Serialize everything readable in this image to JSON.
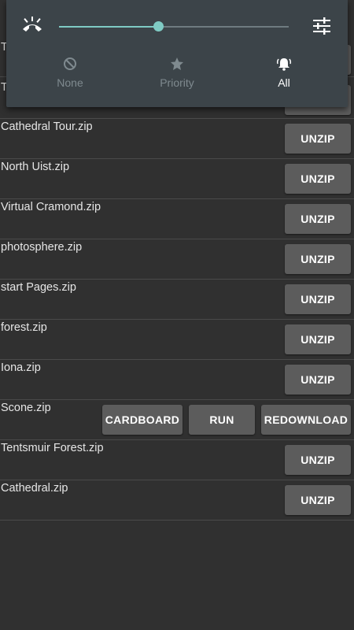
{
  "files": [
    {
      "name": "Cathedral Tour.zip",
      "action": "UNZIP"
    },
    {
      "name": "North Uist.zip",
      "action": "UNZIP"
    },
    {
      "name": "Virtual Cramond.zip",
      "action": "UNZIP"
    },
    {
      "name": "photosphere.zip",
      "action": "UNZIP"
    },
    {
      "name": "start Pages.zip",
      "action": "UNZIP"
    },
    {
      "name": "forest.zip",
      "action": "UNZIP"
    },
    {
      "name": "Iona.zip",
      "action": "UNZIP"
    },
    {
      "name": "Scone.zip",
      "actions": [
        "CARDBOARD",
        "RUN",
        "REDOWNLOAD"
      ]
    },
    {
      "name": "Tentsmuir Forest.zip",
      "action": "UNZIP"
    },
    {
      "name": "Cathedral.zip",
      "action": "UNZIP"
    }
  ],
  "hidden_rows_prefix": [
    "T",
    "T"
  ],
  "volume_panel": {
    "level": 0.43,
    "accent_color": "#7fcbc4",
    "left_icon": "ringer-icon",
    "right_icon": "settings-sliders-icon",
    "modes": [
      {
        "label": "None",
        "icon": "block-icon",
        "active": false
      },
      {
        "label": "Priority",
        "icon": "star-icon",
        "active": false
      },
      {
        "label": "All",
        "icon": "bell-icon",
        "active": true
      }
    ]
  }
}
